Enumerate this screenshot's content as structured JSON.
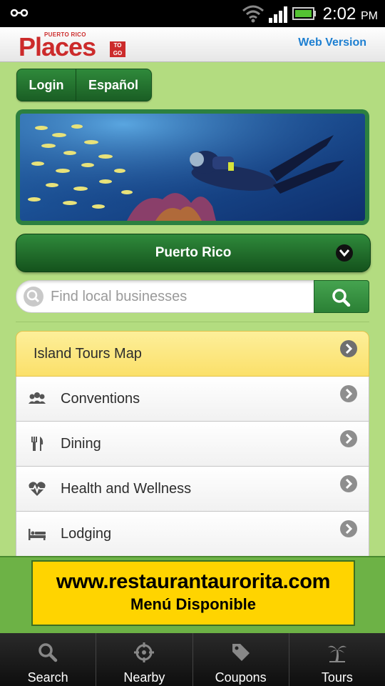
{
  "status_bar": {
    "time": "2:02",
    "ampm": "PM"
  },
  "header": {
    "logo_top": "PUERTO RICO",
    "logo_main": "Places",
    "logo_badge_line1": "TO",
    "logo_badge_line2": "GO",
    "web_version": "Web Version"
  },
  "account": {
    "login": "Login",
    "language": "Español"
  },
  "region": {
    "label": "Puerto Rico",
    "icon": "chevron-down-icon"
  },
  "search": {
    "placeholder": "Find local businesses",
    "value": ""
  },
  "categories": [
    {
      "label": "Island Tours Map",
      "icon": ""
    },
    {
      "label": "Conventions",
      "icon": "people-icon"
    },
    {
      "label": "Dining",
      "icon": "fork-knife-icon"
    },
    {
      "label": "Health and Wellness",
      "icon": "heartbeat-icon"
    },
    {
      "label": "Lodging",
      "icon": "bed-icon"
    }
  ],
  "ad": {
    "url": "www.restaurantaurorita.com",
    "tagline": "Menú Disponible"
  },
  "tabs": [
    {
      "label": "Search",
      "icon": "search-icon"
    },
    {
      "label": "Nearby",
      "icon": "crosshair-icon"
    },
    {
      "label": "Coupons",
      "icon": "tag-icon"
    },
    {
      "label": "Tours",
      "icon": "palm-tree-icon"
    }
  ],
  "colors": {
    "primary_green": "#1a5e24",
    "background": "#b3dc80",
    "highlight_yellow": "#fbe06a",
    "link_blue": "#1d7fd1",
    "brand_red": "#cc2b2b"
  }
}
